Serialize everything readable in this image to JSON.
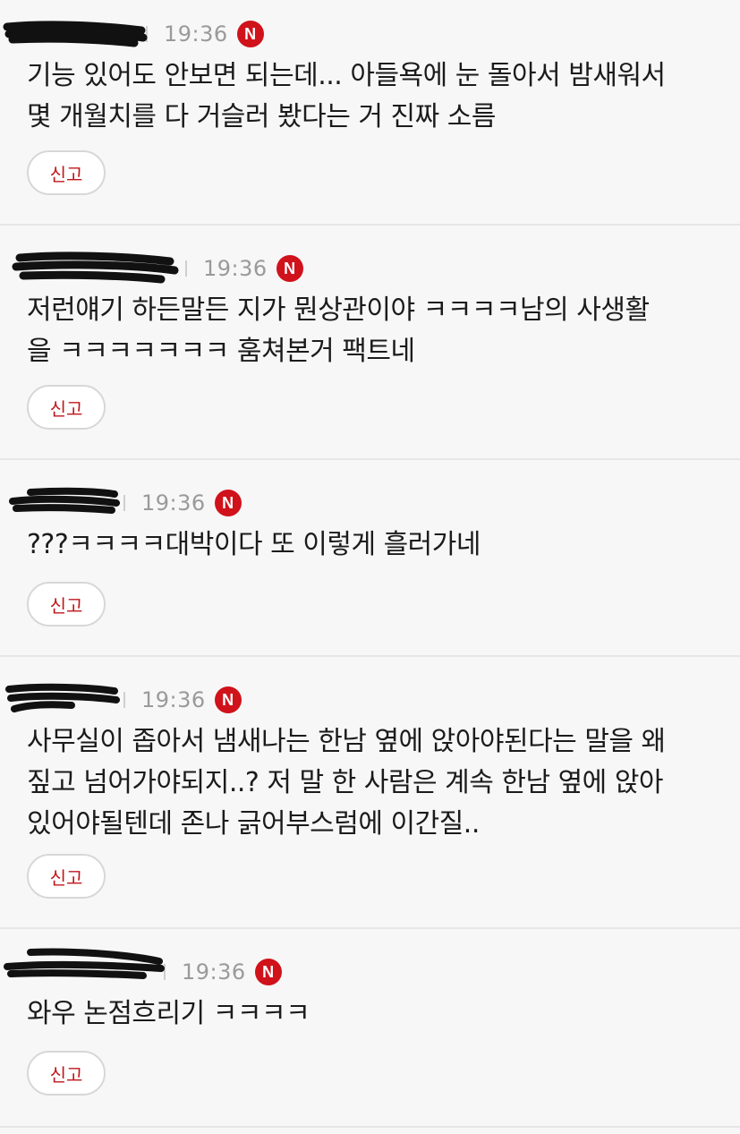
{
  "comments": [
    {
      "time": "19:36",
      "badge": "N",
      "text": "기능 있어도 안보면 되는데... 아들욕에 눈 돌아서 밤새워서\n몇 개월치를 다 거슬러 봤다는 거 진짜 소름",
      "report_label": "신고"
    },
    {
      "time": "19:36",
      "badge": "N",
      "text": "저런얘기 하든말든 지가 뭔상관이야 ㅋㅋㅋㅋ남의 사생활\n을 ㅋㅋㅋㅋㅋㅋㅋ 훔쳐본거 팩트네",
      "report_label": "신고"
    },
    {
      "time": "19:36",
      "badge": "N",
      "text": "???ㅋㅋㅋㅋ대박이다 또 이렇게 흘러가네",
      "report_label": "신고"
    },
    {
      "time": "19:36",
      "badge": "N",
      "text": "사무실이 좁아서 냄새나는 한남 옆에 앉아야된다는 말을 왜\n짚고 넘어가야되지..? 저 말 한 사람은 계속 한남 옆에 앉아\n있어야될텐데 존나 긁어부스럼에 이간질..",
      "report_label": "신고"
    },
    {
      "time": "19:36",
      "badge": "N",
      "text": "와우 논점흐리기 ㅋㅋㅋㅋ",
      "report_label": "신고"
    }
  ],
  "colors": {
    "badge": "#d0121b",
    "report_text": "#c0151b",
    "time_text": "#9a9a9a",
    "body_text": "#1b1b1b",
    "background": "#f7f7f7"
  },
  "icons": {
    "redaction": "redaction-scribble",
    "badge": "new-badge-icon"
  }
}
